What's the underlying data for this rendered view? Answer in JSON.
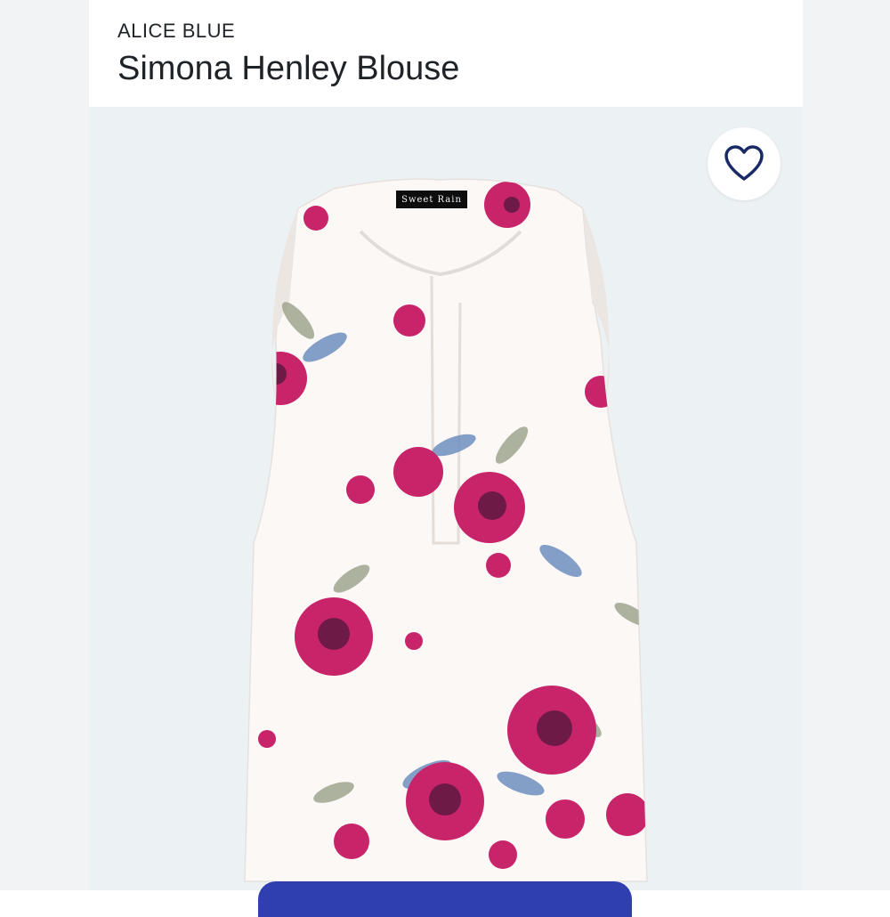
{
  "header": {
    "brand": "ALICE BLUE",
    "title": "Simona Henley Blouse"
  },
  "product": {
    "label_tag": "Sweet Rain",
    "print_colors": {
      "fabric": "#fbf8f6",
      "flower": "#c8246a",
      "flower_dark": "#6e1a46",
      "leaf_blue": "#6d8fbf",
      "leaf_sage": "#9aa08a"
    }
  },
  "icons": {
    "favorite": "heart-icon"
  },
  "colors": {
    "background": "#ecf1f3",
    "accent": "#1a2a66",
    "button": "#2f3fb0"
  }
}
